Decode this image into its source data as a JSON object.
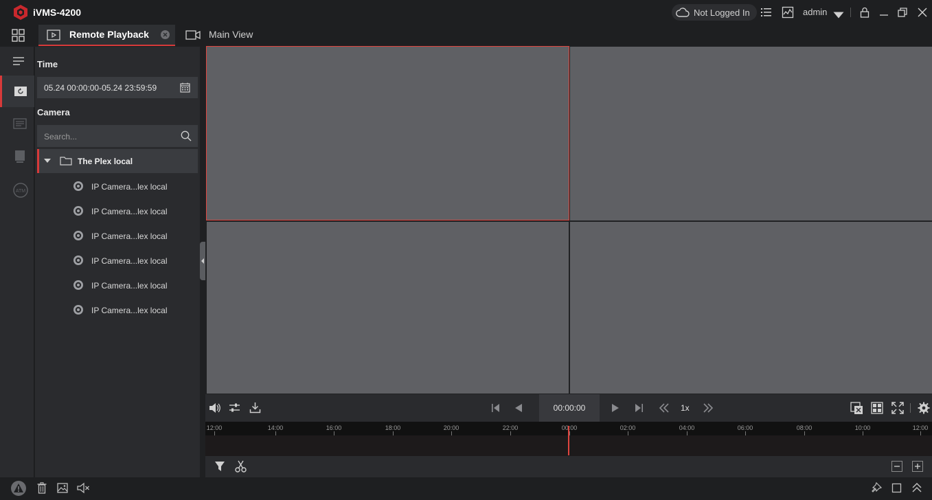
{
  "app": {
    "title": "iVMS-4200"
  },
  "header": {
    "cloud_status": "Not Logged In",
    "user": "admin"
  },
  "tabs": [
    {
      "label": "Remote Playback",
      "active": true
    },
    {
      "label": "Main View",
      "active": false
    }
  ],
  "panel": {
    "time_heading": "Time",
    "time_range": "05.24 00:00:00-05.24 23:59:59",
    "camera_heading": "Camera",
    "search_placeholder": "Search...",
    "tree_root": "The Plex local",
    "cameras": [
      "IP Camera...lex local",
      "IP Camera...lex local",
      "IP Camera...lex local",
      "IP Camera...lex local",
      "IP Camera...lex local",
      "IP Camera...lex local"
    ]
  },
  "playback": {
    "time": "00:00:00",
    "speed": "1x"
  },
  "timeline": {
    "labels": [
      "12:00",
      "14:00",
      "16:00",
      "18:00",
      "20:00",
      "22:00",
      "00:00",
      "02:00",
      "04:00",
      "06:00",
      "08:00",
      "10:00",
      "12:00"
    ]
  },
  "colors": {
    "accent": "#e0453f",
    "pane": "#5f6064",
    "background": "#1f2022"
  },
  "icons": [
    "app-logo-icon",
    "cloud-icon",
    "list-icon",
    "chart-icon",
    "dropdown-icon",
    "lock-icon",
    "minimize-icon",
    "restore-icon",
    "close-icon",
    "home-grid-icon",
    "playback-tab-icon",
    "tab-close-icon",
    "camera-tab-icon",
    "menu-icon",
    "playback-icon",
    "event-icon",
    "storage-icon",
    "atm-icon",
    "calendar-icon",
    "search-icon",
    "folder-icon",
    "camera-icon",
    "volume-icon",
    "adjust-icon",
    "download-icon",
    "previous-frame-icon",
    "reverse-play-icon",
    "play-icon",
    "next-frame-icon",
    "slow-icon",
    "fast-icon",
    "stop-all-icon",
    "layout-icon",
    "fullscreen-icon",
    "settings-icon",
    "filter-icon",
    "clip-icon",
    "zoom-out-icon",
    "zoom-in-icon",
    "alarm-icon",
    "delete-icon",
    "picture-icon",
    "mute-icon",
    "pin-icon",
    "window-icon",
    "expand-up-icon"
  ]
}
